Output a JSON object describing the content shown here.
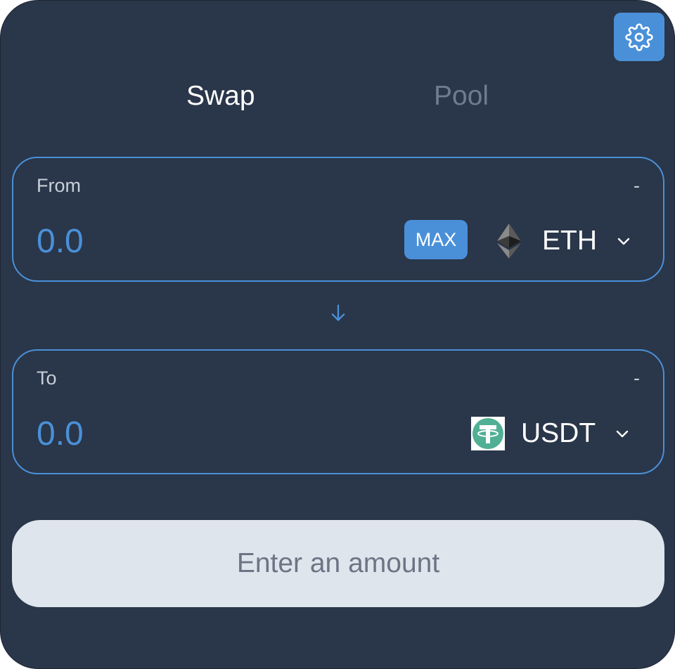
{
  "tabs": [
    {
      "label": "Swap",
      "active": true
    },
    {
      "label": "Pool",
      "active": false
    }
  ],
  "from": {
    "label": "From",
    "balance": "-",
    "amount_placeholder": "0.0",
    "max_label": "MAX",
    "token_symbol": "ETH",
    "token_icon": "ethereum-icon"
  },
  "to": {
    "label": "To",
    "balance": "-",
    "amount_placeholder": "0.0",
    "token_symbol": "USDT",
    "token_icon": "tether-icon"
  },
  "submit_label": "Enter an amount",
  "colors": {
    "background": "#2a3649",
    "accent": "#4a90d9",
    "button_disabled": "#dfe5ec",
    "tether_green": "#50af95"
  }
}
